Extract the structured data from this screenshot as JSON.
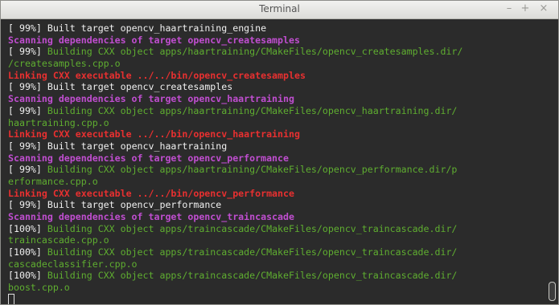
{
  "window": {
    "title": "Terminal",
    "minimize_glyph": "–",
    "maximize_glyph": "+",
    "close_glyph": "×"
  },
  "terminal": {
    "lines": [
      {
        "segments": [
          {
            "text": "[ 99%] ",
            "color": "white"
          },
          {
            "text": "Built target opencv_haartraining_engine",
            "color": "white"
          }
        ]
      },
      {
        "segments": [
          {
            "text": "Scanning dependencies of target opencv_createsamples",
            "color": "magenta"
          }
        ]
      },
      {
        "segments": [
          {
            "text": "[ 99%] ",
            "color": "white"
          },
          {
            "text": "Building CXX object apps/haartraining/CMakeFiles/opencv_createsamples.dir/",
            "color": "green"
          }
        ]
      },
      {
        "segments": [
          {
            "text": "/createsamples.cpp.o",
            "color": "green"
          }
        ]
      },
      {
        "segments": [
          {
            "text": "Linking CXX executable ../../bin/opencv_createsamples",
            "color": "red"
          }
        ]
      },
      {
        "segments": [
          {
            "text": "[ 99%] ",
            "color": "white"
          },
          {
            "text": "Built target opencv_createsamples",
            "color": "white"
          }
        ]
      },
      {
        "segments": [
          {
            "text": "Scanning dependencies of target opencv_haartraining",
            "color": "magenta"
          }
        ]
      },
      {
        "segments": [
          {
            "text": "[ 99%] ",
            "color": "white"
          },
          {
            "text": "Building CXX object apps/haartraining/CMakeFiles/opencv_haartraining.dir/",
            "color": "green"
          }
        ]
      },
      {
        "segments": [
          {
            "text": "haartraining.cpp.o",
            "color": "green"
          }
        ]
      },
      {
        "segments": [
          {
            "text": "Linking CXX executable ../../bin/opencv_haartraining",
            "color": "red"
          }
        ]
      },
      {
        "segments": [
          {
            "text": "[ 99%] ",
            "color": "white"
          },
          {
            "text": "Built target opencv_haartraining",
            "color": "white"
          }
        ]
      },
      {
        "segments": [
          {
            "text": "Scanning dependencies of target opencv_performance",
            "color": "magenta"
          }
        ]
      },
      {
        "segments": [
          {
            "text": "[ 99%] ",
            "color": "white"
          },
          {
            "text": "Building CXX object apps/haartraining/CMakeFiles/opencv_performance.dir/p",
            "color": "green"
          }
        ]
      },
      {
        "segments": [
          {
            "text": "erformance.cpp.o",
            "color": "green"
          }
        ]
      },
      {
        "segments": [
          {
            "text": "Linking CXX executable ../../bin/opencv_performance",
            "color": "red"
          }
        ]
      },
      {
        "segments": [
          {
            "text": "[ 99%] ",
            "color": "white"
          },
          {
            "text": "Built target opencv_performance",
            "color": "white"
          }
        ]
      },
      {
        "segments": [
          {
            "text": "Scanning dependencies of target opencv_traincascade",
            "color": "magenta"
          }
        ]
      },
      {
        "segments": [
          {
            "text": "[100%] ",
            "color": "white"
          },
          {
            "text": "Building CXX object apps/traincascade/CMakeFiles/opencv_traincascade.dir/",
            "color": "green"
          }
        ]
      },
      {
        "segments": [
          {
            "text": "traincascade.cpp.o",
            "color": "green"
          }
        ]
      },
      {
        "segments": [
          {
            "text": "[100%] ",
            "color": "white"
          },
          {
            "text": "Building CXX object apps/traincascade/CMakeFiles/opencv_traincascade.dir/",
            "color": "green"
          }
        ]
      },
      {
        "segments": [
          {
            "text": "cascadeclassifier.cpp.o",
            "color": "green"
          }
        ]
      },
      {
        "segments": [
          {
            "text": "[100%] ",
            "color": "white"
          },
          {
            "text": "Building CXX object apps/traincascade/CMakeFiles/opencv_traincascade.dir/",
            "color": "green"
          }
        ]
      },
      {
        "segments": [
          {
            "text": "boost.cpp.o",
            "color": "green"
          }
        ]
      }
    ]
  },
  "colors": {
    "background": "#2b2b2b",
    "white": "#f0f0f0",
    "green": "#5fae30",
    "magenta": "#c04ed0",
    "red": "#e83030"
  },
  "icons": {
    "cursor": "block-cursor-outline",
    "minimize": "minimize-icon",
    "maximize": "maximize-icon",
    "close": "close-icon"
  }
}
